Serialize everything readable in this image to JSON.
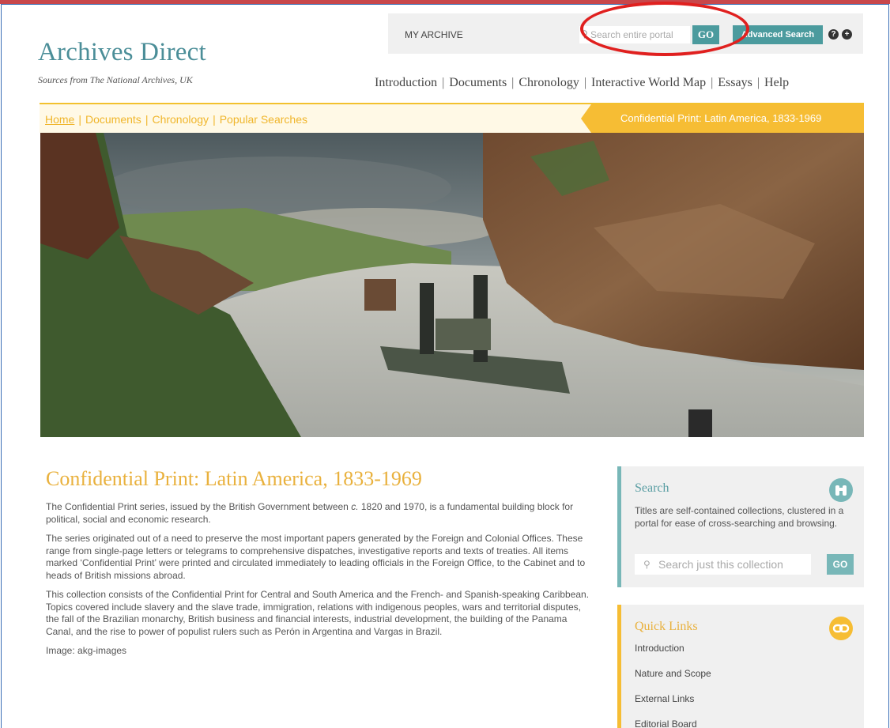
{
  "header": {
    "logo_title": "Archives Direct",
    "logo_subtitle": "Sources from The National Archives, UK",
    "my_archive": "MY ARCHIVE",
    "search_placeholder": "Search entire portal",
    "go_label": "GO",
    "advanced_search_label": "Advanced Search",
    "help_glyph": "?",
    "plus_glyph": "+"
  },
  "main_nav": [
    "Introduction",
    "Documents",
    "Chronology",
    "Interactive World Map",
    "Essays",
    "Help"
  ],
  "breadcrumbs": [
    "Home",
    "Documents",
    "Chronology",
    "Popular Searches"
  ],
  "collection_tab": "Confidential Print: Latin America, 1833-1969",
  "content": {
    "title": "Confidential Print: Latin America, 1833-1969",
    "paragraphs": [
      {
        "before": "The Confidential Print series, issued by the British Government between ",
        "italic": "c.",
        "after": " 1820 and 1970, is a fundamental building block for political, social and economic research."
      },
      "The series originated out of a need to preserve the most important papers generated by the Foreign and Colonial Offices. These range from single-page letters or telegrams to comprehensive dispatches, investigative reports and texts of treaties. All items marked ‘Confidential Print’ were printed and circulated immediately to leading officials in the Foreign Office, to the Cabinet and to heads of British missions abroad.",
      "This collection consists of the Confidential Print for Central and South America and the French- and Spanish-speaking Caribbean. Topics covered include slavery and the slave trade, immigration, relations with indigenous peoples, wars and territorial disputes, the fall of the Brazilian monarchy, British business and financial interests, industrial development, the building of the Panama Canal, and the rise to power of populist rulers such as Perón in Argentina and Vargas in Brazil.",
      "Image: akg-images"
    ]
  },
  "sidebar": {
    "search": {
      "heading": "Search",
      "description": "Titles are self-contained collections, clustered in a portal for ease of cross-searching and browsing.",
      "placeholder": "Search just this collection",
      "go_label": "GO"
    },
    "quick_links": {
      "heading": "Quick Links",
      "items": [
        "Introduction",
        "Nature and Scope",
        "External Links",
        "Editorial Board"
      ]
    }
  },
  "colors": {
    "teal": "#4b9b9e",
    "gold": "#f6bd34",
    "annotation_red": "#e0201f"
  }
}
